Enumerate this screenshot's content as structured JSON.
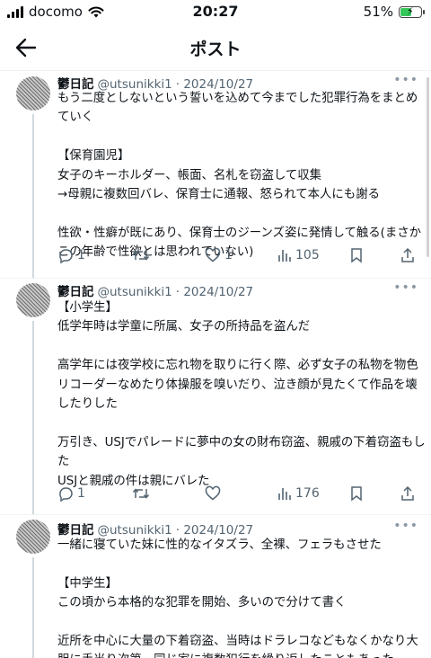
{
  "status_bar": {
    "carrier": "docomo",
    "time": "20:27",
    "battery": "51%"
  },
  "header": {
    "title": "ポスト"
  },
  "tweets": [
    {
      "name": "鬱日記",
      "handle": "@utsunikki1",
      "date": "· 2024/10/27",
      "text": "もう二度としないという誓いを込めて今までした犯罪行為をまとめていく\n\n【保育園児】\n女子のキーホルダー、帳面、名札を窃盗して収集\n→母親に複数回バレ、保育士に通報、怒られて本人にも謝る\n\n性欲・性癖が既にあり、保育士のジーンズ姿に発情して触る(まさかこの年齢で性欲とは思われていない)",
      "replies": "1",
      "retweets": "",
      "likes": "1",
      "views": "105"
    },
    {
      "name": "鬱日記",
      "handle": "@utsunikki1",
      "date": "· 2024/10/27",
      "text": "【小学生】\n低学年時は学童に所属、女子の所持品を盗んだ\n\n高学年には夜学校に忘れ物を取りに行く際、必ず女子の私物を物色\nリコーダーなめたり体操服を嗅いだり、泣き顔が見たくて作品を壊したりした\n\n万引き、USJでパレードに夢中の女の財布窃盗、親戚の下着窃盗もした\nUSJと親戚の件は親にバレた",
      "replies": "1",
      "retweets": "",
      "likes": "",
      "views": "176"
    },
    {
      "name": "鬱日記",
      "handle": "@utsunikki1",
      "date": "· 2024/10/27",
      "text": "一緒に寝ていた妹に性的なイタズラ、全裸、フェラもさせた\n\n【中学生】\nこの頃から本格的な犯罪を開始、多いので分けて書く\n\n近所を中心に大量の下着窃盗、当時はドラレコなどもなくかなり大胆に手当り次第、同じ家に複数犯行を繰り返したこともあった",
      "replies": "",
      "retweets": "",
      "likes": "",
      "views": ""
    }
  ]
}
